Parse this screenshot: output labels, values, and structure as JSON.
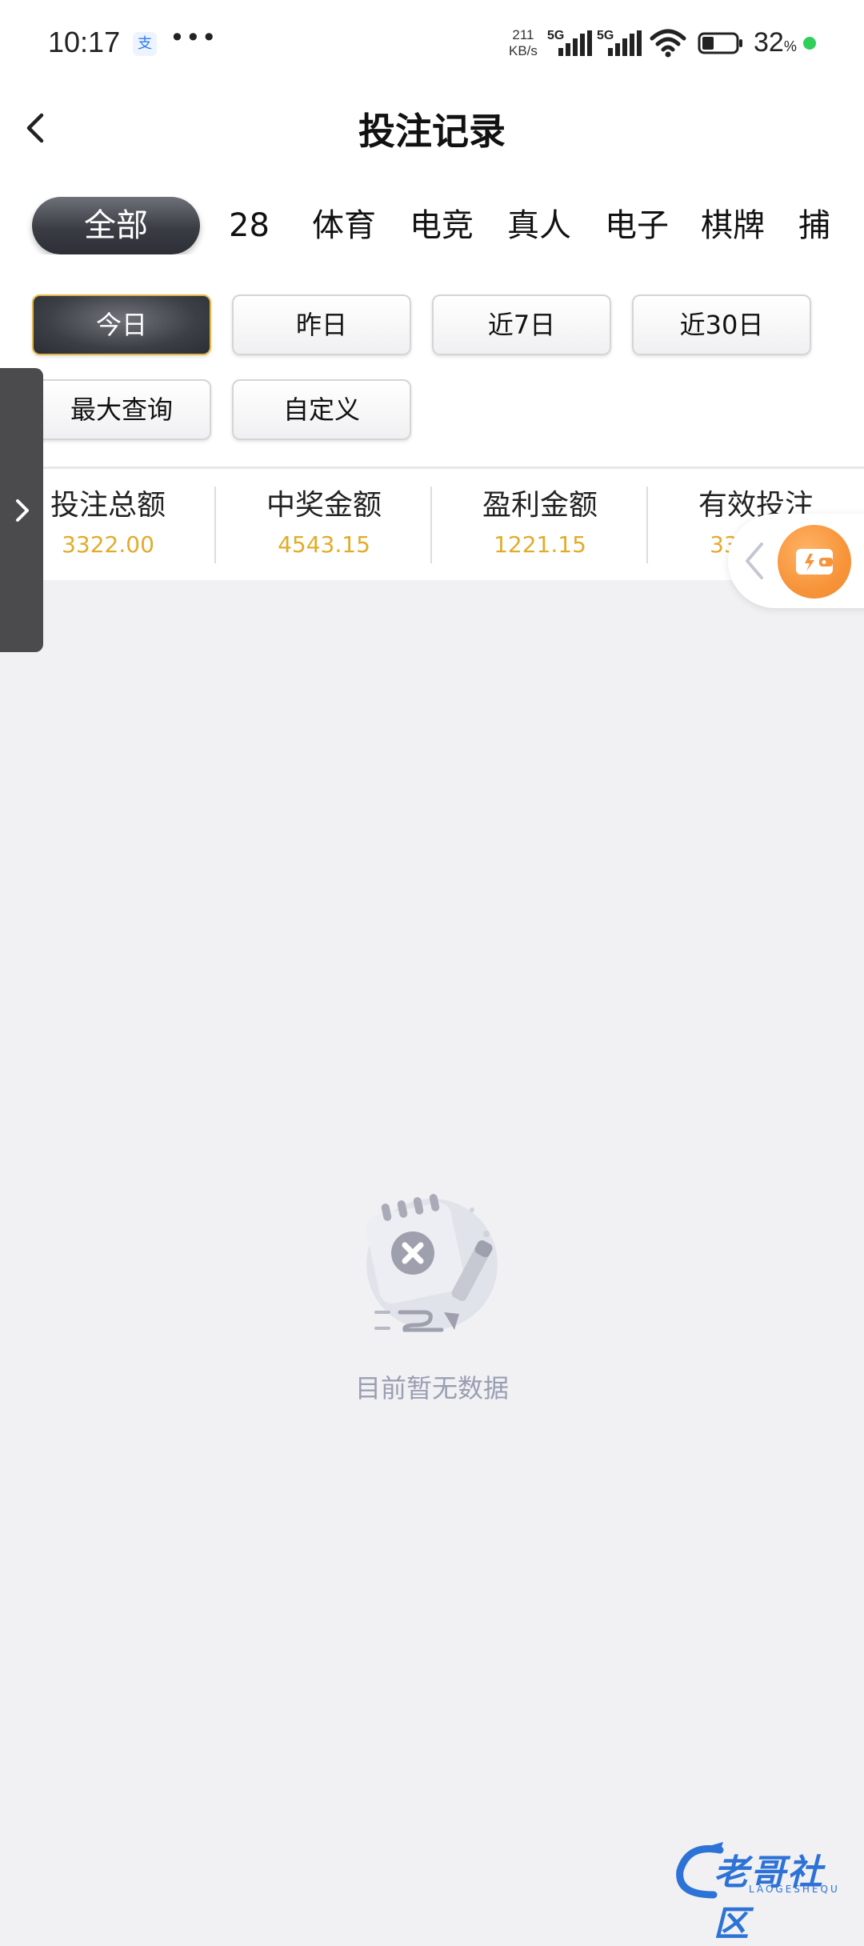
{
  "status_bar": {
    "time": "10:17",
    "app_icon_glyph": "支",
    "more_dots": "•••",
    "net_speed_value": "211",
    "net_speed_unit": "KB/s",
    "network_1": "5G",
    "network_2": "5G",
    "battery_percent": "32",
    "battery_unit": "%",
    "icons": [
      "alipay-icon",
      "signal-icon",
      "wifi-icon",
      "battery-icon"
    ]
  },
  "header": {
    "title": "投注记录",
    "back_icon": "chevron-left-icon"
  },
  "category_tabs": [
    {
      "label": "全部",
      "active": true
    },
    {
      "label": "28",
      "active": false
    },
    {
      "label": "体育",
      "active": false
    },
    {
      "label": "电竞",
      "active": false
    },
    {
      "label": "真人",
      "active": false
    },
    {
      "label": "电子",
      "active": false
    },
    {
      "label": "棋牌",
      "active": false
    },
    {
      "label": "捕鱼",
      "active": false
    }
  ],
  "date_filters": [
    {
      "label": "今日",
      "active": true
    },
    {
      "label": "昨日",
      "active": false
    },
    {
      "label": "近7日",
      "active": false
    },
    {
      "label": "近30日",
      "active": false
    },
    {
      "label": "最大查询",
      "active": false
    },
    {
      "label": "自定义",
      "active": false
    }
  ],
  "summary": [
    {
      "label": "投注总额",
      "value": "3322.00"
    },
    {
      "label": "中奖金额",
      "value": "4543.15"
    },
    {
      "label": "盈利金额",
      "value": "1221.15"
    },
    {
      "label": "有效投注",
      "value": "3322.00"
    }
  ],
  "empty_state": {
    "message": "目前暂无数据",
    "icon": "empty-notebook-icon"
  },
  "floating": {
    "wallet_icon": "wallet-icon",
    "collapse_icon": "chevron-left-icon"
  },
  "drawer": {
    "icon": "chevron-right-icon"
  },
  "watermark": {
    "text": "老哥社区",
    "sub": "LAOGESHEQU"
  },
  "colors": {
    "accent_gold": "#e2ac2b",
    "active_dark": "#3a3d44",
    "orange": "#f7943a",
    "background": "#f1f1f3"
  }
}
